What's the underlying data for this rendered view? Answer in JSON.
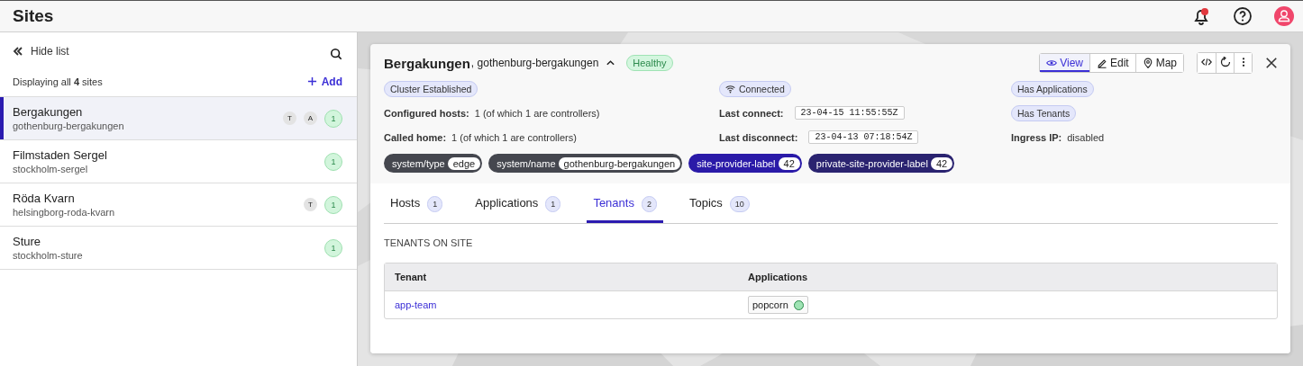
{
  "header": {
    "title": "Sites",
    "notifications_unread": true
  },
  "sidebar": {
    "hide_list": "Hide list",
    "summary": "Displaying all **4** sites",
    "add": "Add",
    "sites": [
      {
        "name": "Bergakungen",
        "slug": "gothenburg-bergakungen",
        "selected": true,
        "tags": [
          "T",
          "A"
        ],
        "count": "1"
      },
      {
        "name": "Filmstaden Sergel",
        "slug": "stockholm-sergel",
        "selected": false,
        "count": "1"
      },
      {
        "name": "Röda Kvarn",
        "slug": "helsingborg-roda-kvarn",
        "selected": false,
        "tags": [
          "T"
        ],
        "count": "1"
      },
      {
        "name": "Sture",
        "slug": "stockholm-sture",
        "selected": false,
        "count": "1"
      }
    ]
  },
  "detail": {
    "name": "Bergakungen",
    "slug": ", gothenburg-bergakungen",
    "health": "Healthy",
    "modes": [
      {
        "label": "View",
        "kind": "view",
        "selected": true
      },
      {
        "label": "Edit",
        "kind": "edit",
        "selected": false
      },
      {
        "label": "Map",
        "kind": "map",
        "selected": false
      }
    ],
    "info": [
      {
        "kind": "badge",
        "text": "Cluster Established"
      },
      {
        "kind": "connection",
        "text": "Connected"
      },
      {
        "kind": "badge",
        "text": "Has Applications"
      },
      {
        "kind": "field",
        "label": "Configured hosts:",
        "value": "1 (of which 1 are controllers)"
      },
      {
        "kind": "timestamp",
        "label": "Last connect:",
        "value": "23-04-15 11:55:55Z"
      },
      {
        "kind": "badge",
        "text": "Has Tenants"
      },
      {
        "kind": "field",
        "label": "Called home:",
        "value": "1 (of which 1 are controllers)"
      },
      {
        "kind": "timestamp",
        "label": "Last disconnect:",
        "value": "23-04-13 07:18:54Z"
      },
      {
        "kind": "field",
        "label": "Ingress IP:",
        "value": "disabled"
      }
    ],
    "labels": [
      {
        "key": "system/type",
        "value": "edge",
        "color": "#45474f"
      },
      {
        "key": "system/name",
        "value": "gothenburg-bergakungen",
        "color": "#45474f"
      },
      {
        "key": "site-provider-label",
        "value": "42",
        "color": "#2a1aa8"
      },
      {
        "key": "private-site-provider-label",
        "value": "42",
        "color": "#2a2370"
      }
    ],
    "tabs": [
      {
        "label": "Hosts",
        "count": "1",
        "selected": false
      },
      {
        "label": "Applications",
        "count": "1",
        "selected": false
      },
      {
        "label": "Tenants",
        "count": "2",
        "selected": true
      },
      {
        "label": "Topics",
        "count": "10",
        "selected": false
      }
    ],
    "section_title": "TENANTS ON SITE",
    "table": {
      "columns": [
        "Tenant",
        "Applications"
      ],
      "rows": [
        {
          "tenant": "app-team",
          "applications": [
            {
              "name": "popcorn",
              "color": "#9fe3b4"
            }
          ]
        }
      ]
    }
  }
}
